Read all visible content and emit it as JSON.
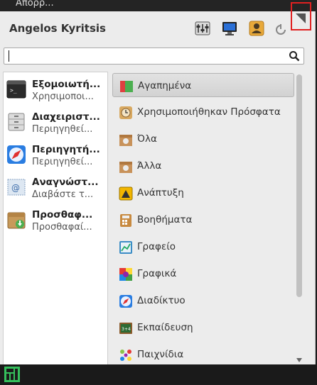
{
  "top_strip": {
    "partial_text": "Απορρ..."
  },
  "header": {
    "username": "Angelos Kyritsis"
  },
  "search": {
    "value": "",
    "placeholder": ""
  },
  "favorites": [
    {
      "title": "Εξομοιωτή...",
      "subtitle": "Χρησιμοποι...",
      "icon": "terminal-icon"
    },
    {
      "title": "Διαχειριστ...",
      "subtitle": "Περιηγηθεί...",
      "icon": "file-cabinet-icon"
    },
    {
      "title": "Περιηγητή...",
      "subtitle": "Περιηγηθεί...",
      "icon": "safari-compass-icon"
    },
    {
      "title": "Αναγνώστ...",
      "subtitle": "Διαβάστε τ...",
      "icon": "email-stamp-icon"
    },
    {
      "title": "Προσθαφ...",
      "subtitle": "Προσθαφαί...",
      "icon": "package-install-icon"
    }
  ],
  "categories": [
    {
      "label": "Αγαπημένα",
      "icon": "bookmark-folder-icon",
      "selected": true
    },
    {
      "label": "Χρησιμοποιήθηκαν Πρόσφατα",
      "icon": "clock-icon"
    },
    {
      "label": "Όλα",
      "icon": "applications-box-icon"
    },
    {
      "label": "Άλλα",
      "icon": "other-apps-box-icon"
    },
    {
      "label": "Ανάπτυξη",
      "icon": "construction-sign-icon"
    },
    {
      "label": "Βοηθήματα",
      "icon": "calculator-icon"
    },
    {
      "label": "Γραφείο",
      "icon": "office-chart-icon"
    },
    {
      "label": "Γραφικά",
      "icon": "graphics-palette-icon"
    },
    {
      "label": "Διαδίκτυο",
      "icon": "internet-compass-icon"
    },
    {
      "label": "Εκπαίδευση",
      "icon": "chalkboard-icon"
    },
    {
      "label": "Παιχνίδια",
      "icon": "dice-icon"
    }
  ],
  "colors": {
    "highlight_border": "#e02020",
    "selected_bg": "#d8d8d8"
  }
}
